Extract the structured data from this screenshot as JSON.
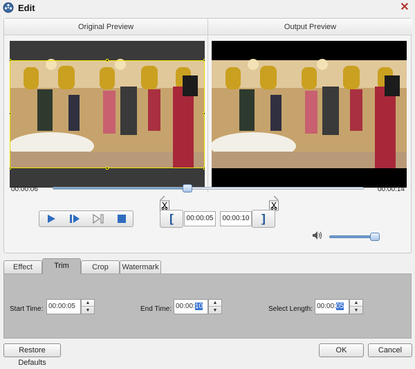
{
  "window": {
    "title": "Edit",
    "icons": {
      "app": "film-reel-icon",
      "close": "close-icon"
    }
  },
  "preview": {
    "original_label": "Original Preview",
    "output_label": "Output Preview"
  },
  "timeline": {
    "current_time": "00:00:06",
    "total_time": "00:00:14",
    "position_fraction": 0.43,
    "trim_start_fraction": 0.36,
    "trim_end_fraction": 0.71
  },
  "playback": {
    "buttons": [
      "play-icon",
      "step-forward-icon",
      "next-frame-icon",
      "stop-icon"
    ],
    "set_start_label": "[",
    "set_end_label": "]",
    "start_value": "00:00:05",
    "end_value": "00:00:10",
    "volume_fraction": 0.92
  },
  "tabs": [
    {
      "label": "Effect",
      "active": false
    },
    {
      "label": "Trim",
      "active": true
    },
    {
      "label": "Crop",
      "active": false
    },
    {
      "label": "Watermark",
      "active": false
    }
  ],
  "trim_panel": {
    "start_time_label": "Start Time:",
    "start_time_value": "00:00:05",
    "end_time_label": "End Time:",
    "end_time_prefix": "00:00:",
    "end_time_selected": "10",
    "select_length_label": "Select Length:",
    "select_length_prefix": "00:00:",
    "select_length_selected": "05"
  },
  "footer": {
    "restore_label": "Restore Defaults",
    "ok_label": "OK",
    "cancel_label": "Cancel"
  },
  "colors": {
    "accent": "#1c4f94",
    "selection": "#3a73d1",
    "crop_border": "#e8e000",
    "close": "#b03a2e"
  }
}
